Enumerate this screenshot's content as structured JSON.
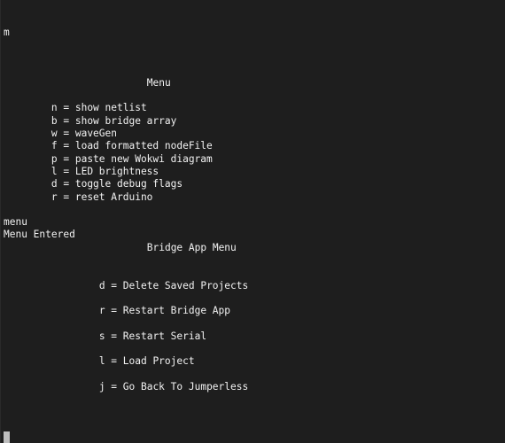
{
  "terminal": {
    "lines": [
      {
        "row": 2,
        "col": 0,
        "text": "m"
      },
      {
        "row": 6,
        "col": 24,
        "text": "Menu"
      },
      {
        "row": 8,
        "col": 8,
        "text": "n = show netlist"
      },
      {
        "row": 9,
        "col": 8,
        "text": "b = show bridge array"
      },
      {
        "row": 10,
        "col": 8,
        "text": "w = waveGen"
      },
      {
        "row": 11,
        "col": 8,
        "text": "f = load formatted nodeFile"
      },
      {
        "row": 12,
        "col": 8,
        "text": "p = paste new Wokwi diagram"
      },
      {
        "row": 13,
        "col": 8,
        "text": "l = LED brightness"
      },
      {
        "row": 14,
        "col": 8,
        "text": "d = toggle debug flags"
      },
      {
        "row": 15,
        "col": 8,
        "text": "r = reset Arduino"
      },
      {
        "row": 17,
        "col": 0,
        "text": "menu"
      },
      {
        "row": 18,
        "col": 0,
        "text": "Menu Entered"
      },
      {
        "row": 19,
        "col": 24,
        "text": "Bridge App Menu"
      },
      {
        "row": 22,
        "col": 16,
        "text": "d = Delete Saved Projects"
      },
      {
        "row": 24,
        "col": 16,
        "text": "r = Restart Bridge App"
      },
      {
        "row": 26,
        "col": 16,
        "text": "s = Restart Serial"
      },
      {
        "row": 28,
        "col": 16,
        "text": "l = Load Project"
      },
      {
        "row": 30,
        "col": 16,
        "text": "j = Go Back To Jumperless"
      }
    ],
    "cursor_row": 34
  },
  "main_menu": {
    "title": "Menu",
    "items": [
      {
        "key": "n",
        "label": "show netlist"
      },
      {
        "key": "b",
        "label": "show bridge array"
      },
      {
        "key": "w",
        "label": "waveGen"
      },
      {
        "key": "f",
        "label": "load formatted nodeFile"
      },
      {
        "key": "p",
        "label": "paste new Wokwi diagram"
      },
      {
        "key": "l",
        "label": "LED brightness"
      },
      {
        "key": "d",
        "label": "toggle debug flags"
      },
      {
        "key": "r",
        "label": "reset Arduino"
      }
    ]
  },
  "bridge_menu": {
    "title": "Bridge App Menu",
    "items": [
      {
        "key": "d",
        "label": "Delete Saved Projects"
      },
      {
        "key": "r",
        "label": "Restart Bridge App"
      },
      {
        "key": "s",
        "label": "Restart Serial"
      },
      {
        "key": "l",
        "label": "Load Project"
      },
      {
        "key": "j",
        "label": "Go Back To Jumperless"
      }
    ]
  },
  "colors": {
    "background": "#1e1e1e",
    "foreground": "#f2f2f2",
    "cursor": "#bdbdbd"
  }
}
